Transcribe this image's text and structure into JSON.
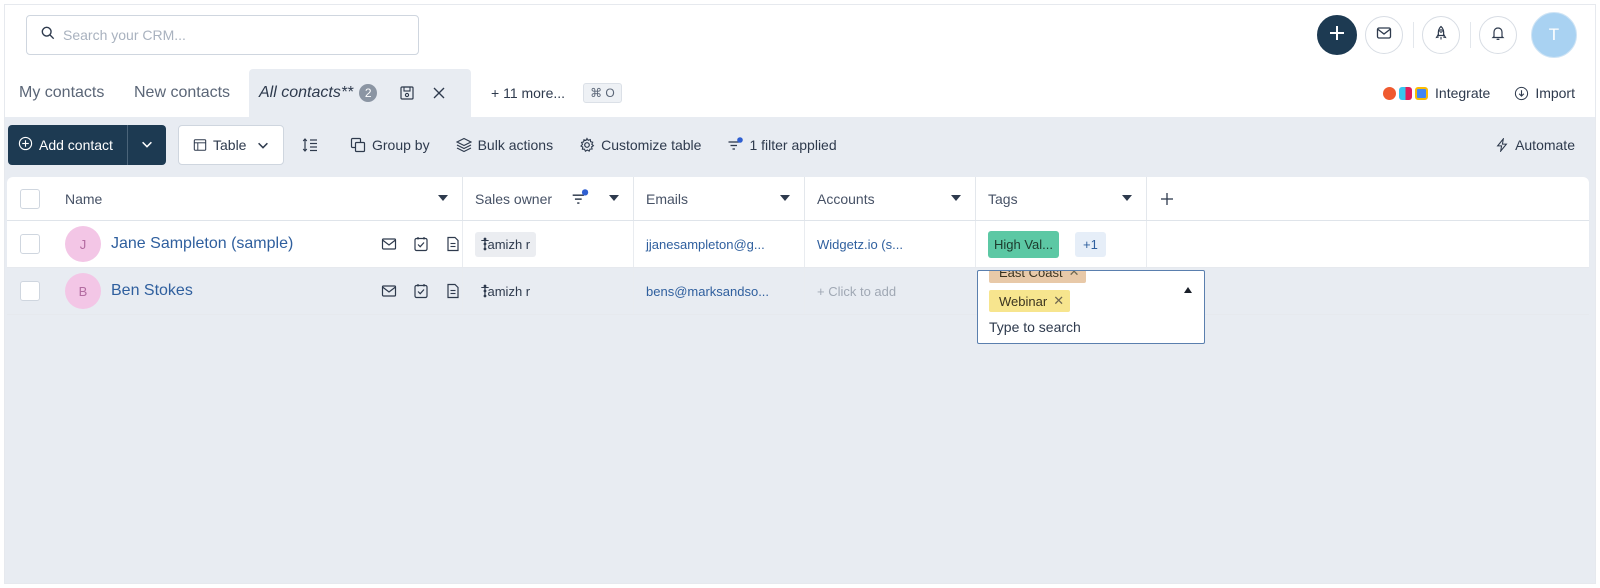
{
  "search": {
    "placeholder": "Search your CRM..."
  },
  "tabs": [
    {
      "label": "My contacts"
    },
    {
      "label": "New contacts"
    },
    {
      "label": "All contacts**",
      "badge": "2"
    }
  ],
  "more_tabs": {
    "label": "+ 11 more...",
    "shortcut": "⌘ O"
  },
  "top_right": {
    "integrate": "Integrate",
    "import": "Import"
  },
  "user_avatar": "T",
  "toolbar": {
    "add_contact": "Add contact",
    "view": "Table",
    "group_by": "Group by",
    "bulk_actions": "Bulk actions",
    "customize": "Customize table",
    "filter": "1 filter applied",
    "automate": "Automate"
  },
  "columns": [
    "Name",
    "Sales owner",
    "Emails",
    "Accounts",
    "Tags"
  ],
  "rows": [
    {
      "initial": "J",
      "name": "Jane Sampleton (sample)",
      "owner": "Tamizh r",
      "email": "jjanesampleton@g...",
      "account": "Widgetz.io (s...",
      "tag": "High Val...",
      "tag_more": "+1"
    },
    {
      "initial": "B",
      "name": "Ben Stokes",
      "owner": "Tamizh r",
      "email": "bens@marksandso...",
      "account": "+ Click to add"
    }
  ],
  "tag_dropdown": {
    "chips": [
      "East Coast",
      "Webinar"
    ],
    "placeholder": "Type to search"
  },
  "colors": {
    "brand": "#1d3a52",
    "link": "#2f5f9e",
    "tag_green": "#5cc8a4",
    "tag_yellow": "#f7e58e",
    "tag_orange": "#e8c9a8"
  }
}
